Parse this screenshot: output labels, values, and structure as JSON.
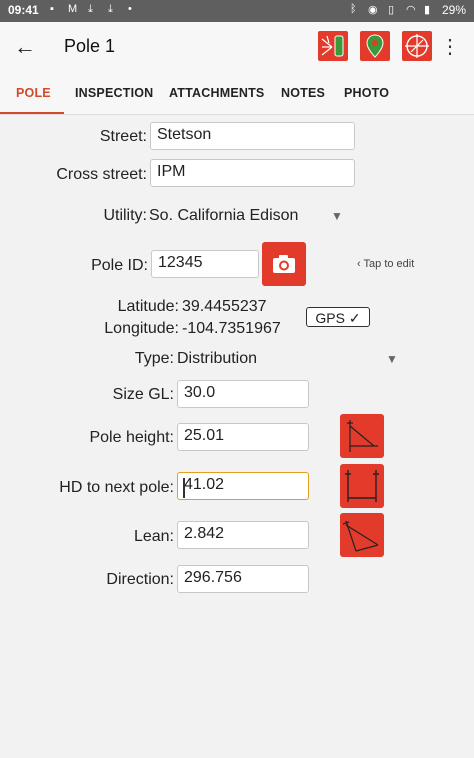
{
  "status": {
    "time": "09:41",
    "battery": "29%"
  },
  "appbar": {
    "title": "Pole 1"
  },
  "tabs": [
    {
      "label": "POLE"
    },
    {
      "label": "INSPECTION"
    },
    {
      "label": "ATTACHMENTS"
    },
    {
      "label": "NOTES"
    },
    {
      "label": "PHOTO"
    }
  ],
  "form": {
    "street": {
      "label": "Street:",
      "value": "Stetson"
    },
    "cross_street": {
      "label": "Cross street:",
      "value": "IPM"
    },
    "utility": {
      "label": "Utility:",
      "value": "So. California Edison"
    },
    "pole_id": {
      "label": "Pole ID:",
      "value": "12345",
      "hint": "Tap to edit"
    },
    "latitude": {
      "label": "Latitude:",
      "value": "39.4455237"
    },
    "longitude": {
      "label": "Longitude:",
      "value": "-104.7351967"
    },
    "gps": {
      "label": "GPS ✓"
    },
    "type": {
      "label": "Type:",
      "value": "Distribution"
    },
    "size_gl": {
      "label": "Size GL:",
      "value": "30.0"
    },
    "pole_height": {
      "label": "Pole height:",
      "value": "25.01"
    },
    "hd_next": {
      "label": "HD to next pole:",
      "value": "41.02"
    },
    "lean": {
      "label": "Lean:",
      "value": "2.842"
    },
    "direction": {
      "label": "Direction:",
      "value": "296.756"
    }
  },
  "colors": {
    "accent": "#e23b2b",
    "tab_active": "#d24a2a",
    "focus": "#e0a020"
  }
}
